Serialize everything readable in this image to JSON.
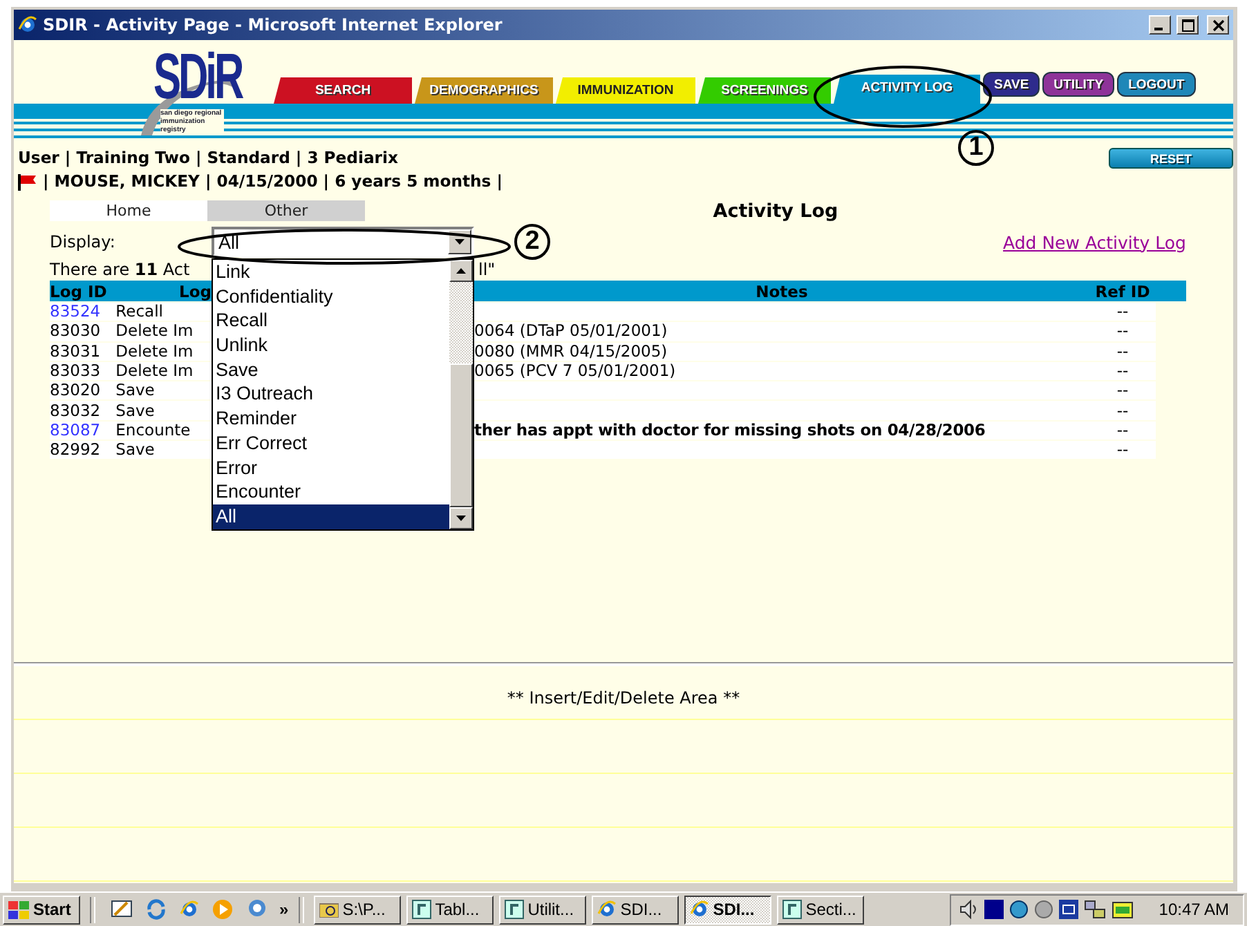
{
  "window": {
    "title": "SDIR - Activity Page - Microsoft Internet Explorer"
  },
  "logo": {
    "letters": "SDiR",
    "tagline": "san diego regional immunization registry"
  },
  "nav": [
    {
      "label": "SEARCH",
      "kind": "tab",
      "color": "#cc1122",
      "selected": false
    },
    {
      "label": "DEMOGRAPHICS",
      "kind": "tab",
      "color": "#c8961a",
      "selected": false
    },
    {
      "label": "IMMUNIZATION",
      "kind": "tab",
      "color": "#f2ee00",
      "selected": false
    },
    {
      "label": "SCREENINGS",
      "kind": "tab",
      "color": "#33cc00",
      "selected": false
    },
    {
      "label": "ACTIVITY LOG",
      "kind": "tab",
      "color": "#0099cc",
      "selected": true
    },
    {
      "label": "SAVE",
      "kind": "button",
      "color": "#2e2b8c",
      "selected": false
    },
    {
      "label": "UTILITY",
      "kind": "button",
      "color": "#8e3399",
      "selected": false
    },
    {
      "label": "LOGOUT",
      "kind": "button",
      "color": "#1f87b8",
      "selected": false
    }
  ],
  "reset_button": "RESET",
  "user_line": "User | Training Two | Standard | 3 Pediarix",
  "patient_line": "| MOUSE, MICKEY | 04/15/2000 | 6 years 5 months |",
  "subtabs": [
    {
      "label": "Home",
      "selected": true
    },
    {
      "label": "Other",
      "selected": false
    }
  ],
  "page_title": "Activity Log",
  "display": {
    "label": "Display:",
    "value": "All",
    "options": [
      {
        "label": "Link",
        "selected": false
      },
      {
        "label": "Confidentiality",
        "selected": false
      },
      {
        "label": "Recall",
        "selected": false
      },
      {
        "label": "Unlink",
        "selected": false
      },
      {
        "label": "Save",
        "selected": false
      },
      {
        "label": "I3 Outreach",
        "selected": false
      },
      {
        "label": "Reminder",
        "selected": false
      },
      {
        "label": "Err Correct",
        "selected": false
      },
      {
        "label": "Error",
        "selected": false
      },
      {
        "label": "Encounter",
        "selected": false
      },
      {
        "label": "All",
        "selected": true
      }
    ]
  },
  "add_link": "Add New Activity Log",
  "summary": {
    "left": "There are **11** Act",
    "right": "ll\""
  },
  "table": {
    "columns": [
      "Log ID",
      "Log",
      "Notes",
      "Ref ID"
    ],
    "rows": [
      {
        "log_id": "83524",
        "linked": true,
        "log_type": "Recall",
        "ref_id": "--"
      },
      {
        "log_id": "83030",
        "linked": false,
        "log_type": "Delete Im",
        "notes": "0064 (DTaP 05/01/2001)",
        "bold_notes": false,
        "ref_id": "--"
      },
      {
        "log_id": "83031",
        "linked": false,
        "log_type": "Delete Im",
        "notes": "0080 (MMR 04/15/2005)",
        "bold_notes": false,
        "ref_id": "--"
      },
      {
        "log_id": "83033",
        "linked": false,
        "log_type": "Delete Im",
        "notes": "0065 (PCV 7 05/01/2001)",
        "bold_notes": false,
        "ref_id": "--"
      },
      {
        "log_id": "83020",
        "linked": false,
        "log_type": "Save",
        "ref_id": "--"
      },
      {
        "log_id": "83032",
        "linked": false,
        "log_type": "Save",
        "ref_id": "--"
      },
      {
        "log_id": "83087",
        "linked": true,
        "log_type": "Encounte",
        "notes": "ther has appt with doctor for missing shots on 04/28/2006",
        "bold_notes": true,
        "ref_id": "--"
      },
      {
        "log_id": "82992",
        "linked": false,
        "log_type": "Save",
        "ref_id": "--"
      }
    ]
  },
  "insert_area": "** Insert/Edit/Delete Area **",
  "annotations": [
    {
      "number": "1"
    },
    {
      "number": "2"
    }
  ],
  "taskbar": {
    "start": "Start",
    "more": "»",
    "tasks": [
      {
        "label": "S:\\P...",
        "kind": "folder",
        "selected": false
      },
      {
        "label": "Tabl...",
        "kind": "document",
        "selected": false
      },
      {
        "label": "Utilit...",
        "kind": "document",
        "selected": false
      },
      {
        "label": "SDI...",
        "kind": "browser",
        "selected": false
      },
      {
        "label": "SDI...",
        "kind": "browser",
        "selected": true
      },
      {
        "label": "Secti...",
        "kind": "document",
        "selected": false
      }
    ],
    "clock": "10:47 AM"
  }
}
